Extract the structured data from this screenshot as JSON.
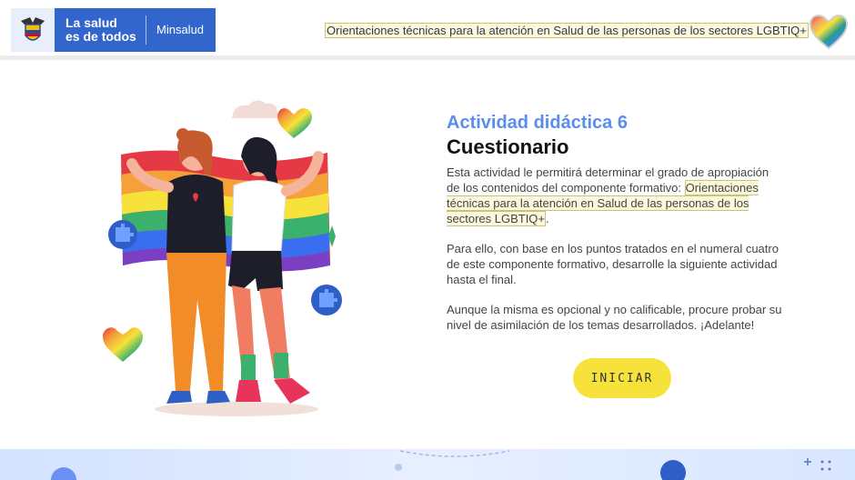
{
  "header": {
    "brand_line1": "La salud",
    "brand_line2": "es de todos",
    "brand_ministry": "Minsalud",
    "course_title": "Orientaciones técnicas para la atención en Salud de las personas de los sectores LGBTIQ+"
  },
  "activity": {
    "subtitle": "Actividad didáctica 6",
    "title": "Cuestionario",
    "para1_prefix": "Esta actividad le permitirá determinar el grado de apropiación de los contenidos del componente formativo: ",
    "para1_link": "Orientaciones técnicas para la atención en Salud de las personas de los sectores LGBTIQ+",
    "para1_suffix": ".",
    "para2": "Para ello, con base en los puntos tratados en el numeral cuatro de este componente formativo, desarrolle la siguiente actividad hasta el final.",
    "para3": "Aunque la misma es opcional y no calificable, procure probar su nivel de asimilación de los temas desarrollados. ¡Adelante!",
    "start_button": "INICIAR"
  },
  "colors": {
    "brand_blue": "#3366cc",
    "subtitle_blue": "#5b8def",
    "button_yellow": "#f6e23a",
    "highlight": "#fbf8dc"
  },
  "icons": [
    "colombia-coat-of-arms-icon",
    "rainbow-heart-icon",
    "puzzle-piece-icon",
    "cloud-icon"
  ]
}
